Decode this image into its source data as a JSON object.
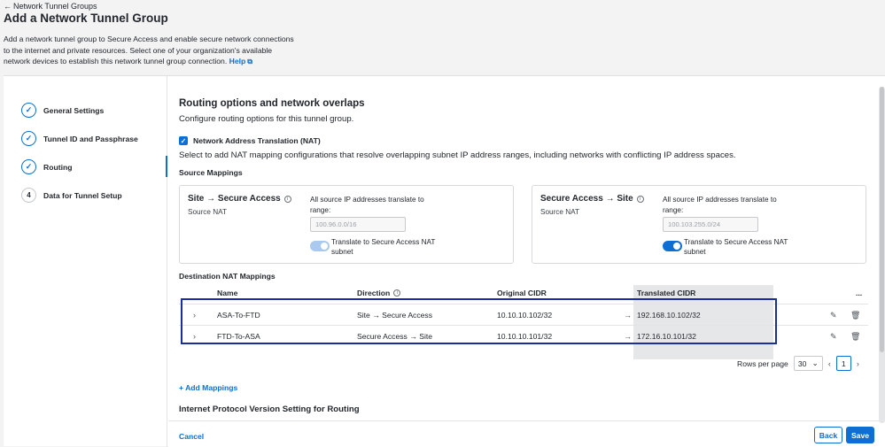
{
  "header": {
    "back_label": "Network Tunnel Groups",
    "title": "Add a Network Tunnel Group",
    "intro": "Add a network tunnel group to Secure Access and enable secure network connections to the internet and private resources. Select one of your organization's available network devices to establish this network tunnel group connection.",
    "help_label": "Help"
  },
  "steps": [
    {
      "label": "General Settings",
      "status": "done"
    },
    {
      "label": "Tunnel ID and Passphrase",
      "status": "done"
    },
    {
      "label": "Routing",
      "status": "active"
    },
    {
      "label": "Data for Tunnel Setup",
      "number": "4"
    }
  ],
  "routing": {
    "title": "Routing options and network overlaps",
    "subtitle": "Configure routing options for this tunnel group.",
    "nat_label": "Network Address Translation (NAT)",
    "nat_desc": "Select to add NAT mapping configurations that resolve overlapping subnet IP address ranges, including networks with conflicting IP address spaces.",
    "source_mappings_label": "Source Mappings",
    "site_to_sa": {
      "title": "Site → Secure Access",
      "sub": "Source NAT",
      "all_label": "All source IP addresses translate to range:",
      "ip_placeholder": "100.96.0.0/16",
      "toggle_label": "Translate to Secure Access NAT subnet"
    },
    "sa_to_site": {
      "title": "Secure Access → Site",
      "sub": "Source NAT",
      "all_label": "All source IP addresses translate to range:",
      "ip_placeholder": "100.103.255.0/24",
      "toggle_label": "Translate to Secure Access NAT subnet"
    },
    "dest_label": "Destination NAT Mappings",
    "columns": {
      "name": "Name",
      "direction": "Direction",
      "original": "Original CIDR",
      "translated": "Translated CIDR",
      "more": "..."
    },
    "rows": [
      {
        "name": "ASA-To-FTD",
        "direction": "Site → Secure Access",
        "original": "10.10.10.102/32",
        "translated": "192.168.10.102/32"
      },
      {
        "name": "FTD-To-ASA",
        "direction": "Secure Access → Site",
        "original": "10.10.10.101/32",
        "translated": "172.16.10.101/32"
      }
    ],
    "rows_per_page_label": "Rows per page",
    "rows_per_page": "30",
    "page": "1",
    "add_mappings": "+ Add Mappings",
    "ipv_title": "Internet Protocol Version Setting for Routing"
  },
  "footer": {
    "cancel": "Cancel",
    "back": "Back",
    "save": "Save"
  }
}
